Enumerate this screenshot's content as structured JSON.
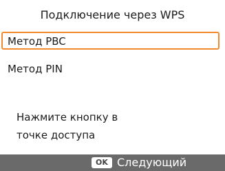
{
  "screen": {
    "title": "Подключение через WPS",
    "accent_color": "#f08a2c",
    "bar_color": "#6a6a6a"
  },
  "menu": {
    "items": [
      {
        "label": "Метод PBC",
        "selected": true
      },
      {
        "label": "Метод PIN",
        "selected": false
      }
    ]
  },
  "hint": {
    "line1": "Нажмите кнопку в",
    "line2": "точке доступа"
  },
  "footer": {
    "ok_label": "OK",
    "next_label": "Следующий"
  }
}
